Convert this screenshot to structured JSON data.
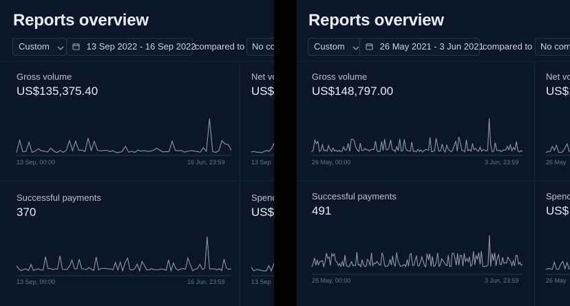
{
  "left": {
    "title": "Reports overview",
    "filter": {
      "preset": "Custom",
      "date_range": "13 Sep 2022 - 16 Sep 2022",
      "compared_label": "compared to",
      "compare_value": "No comparison"
    },
    "gross": {
      "label": "Gross volume",
      "value": "US$135,375.40",
      "start": "13 Sep, 00:00",
      "end": "16 Jun, 23:59"
    },
    "net": {
      "label": "Net volume",
      "value": "US$",
      "start": "13 Sep"
    },
    "payments": {
      "label": "Successful payments",
      "value": "370",
      "start": "13 Sep, 00:00",
      "end": "16 Jun, 23:59"
    },
    "spend": {
      "label": "Spend",
      "value": "US$",
      "start": "13 Sep"
    }
  },
  "right": {
    "title": "Reports overview",
    "filter": {
      "preset": "Custom",
      "date_range": "26 May 2021 - 3 Jun 2021",
      "compared_label": "compared to",
      "compare_value": "No comparison"
    },
    "gross": {
      "label": "Gross volume",
      "value": "US$148,797.00",
      "start": "26 May, 00:00",
      "end": "3 Jun, 23:59"
    },
    "net": {
      "label": "Net volume",
      "value": "US$1",
      "start": "26 May"
    },
    "payments": {
      "label": "Successful payments",
      "value": "491",
      "start": "26 May, 00:00",
      "end": "3 Jun, 23:59"
    },
    "spend": {
      "label": "Spend",
      "value": "US$",
      "start": "26 May"
    }
  },
  "icons": {
    "dropdown": "chevron-down-icon",
    "date": "calendar-icon"
  },
  "colors": {
    "background": "#0b1629",
    "line": "#8e99aa",
    "divider": "#15223a"
  }
}
